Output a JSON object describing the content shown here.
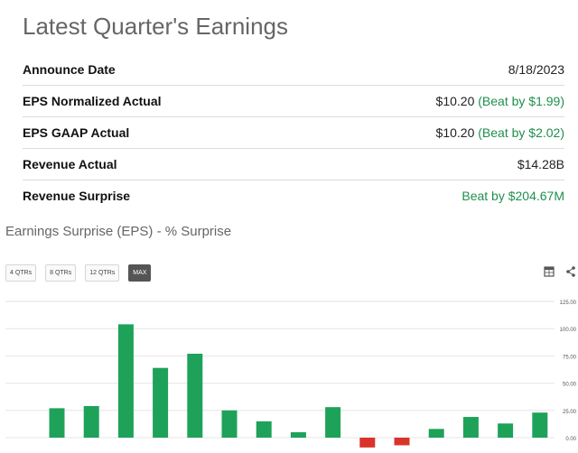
{
  "earnings": {
    "title": "Latest Quarter's Earnings",
    "rows": [
      {
        "label": "Announce Date",
        "value": "8/18/2023",
        "note": ""
      },
      {
        "label": "EPS Normalized Actual",
        "value": "$10.20",
        "note": "(Beat by $1.99)"
      },
      {
        "label": "EPS GAAP Actual",
        "value": "$10.20",
        "note": "(Beat by $2.02)"
      },
      {
        "label": "Revenue Actual",
        "value": "$14.28B",
        "note": ""
      },
      {
        "label": "Revenue Surprise",
        "value": "",
        "note": "Beat by $204.67M"
      }
    ]
  },
  "chart_section": {
    "title": "Earnings Surprise (EPS) - % Surprise",
    "buttons": [
      "4 QTRs",
      "8 QTRs",
      "12 QTRs",
      "MAX"
    ],
    "active_button": "MAX",
    "icons": [
      "calendar-table-icon",
      "share-icon"
    ]
  },
  "colors": {
    "positive": "#1ea25a",
    "negative": "#d9342b",
    "grid": "#e6e6e6"
  },
  "chart_data": {
    "type": "bar",
    "title": "Earnings Surprise (EPS) - % Surprise",
    "xlabel": "",
    "ylabel": "",
    "ylim": [
      0,
      125
    ],
    "yticks": [
      "0.00",
      "25.00",
      "50.00",
      "75.00",
      "100.00",
      "125.00"
    ],
    "grid": true,
    "values": [
      27,
      29,
      104,
      64,
      77,
      25,
      15,
      5,
      28,
      -9,
      -7,
      8,
      19,
      13,
      23
    ]
  }
}
